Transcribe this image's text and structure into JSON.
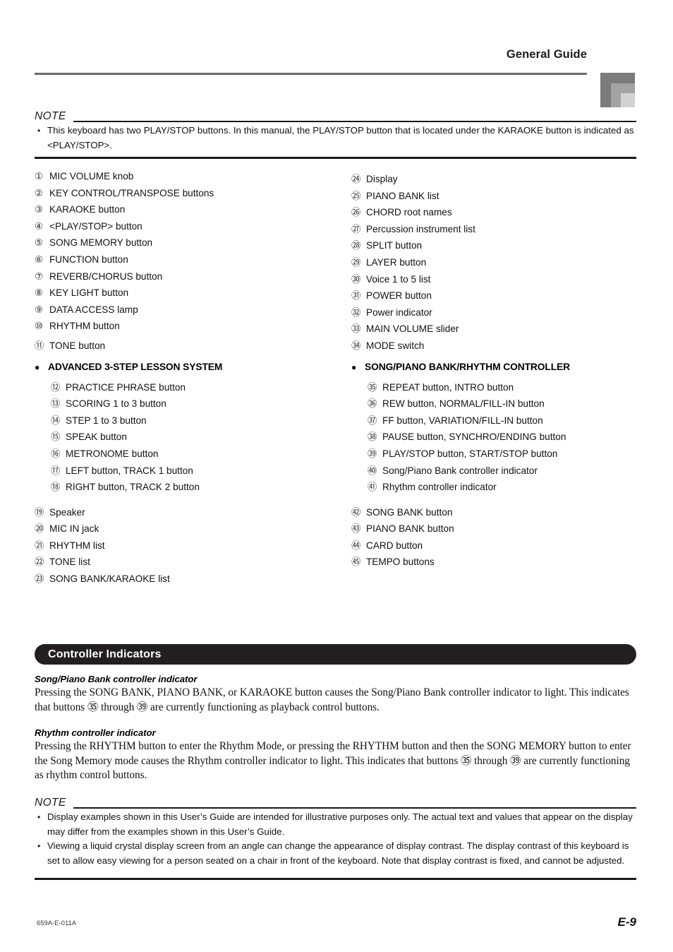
{
  "header": {
    "title": "General Guide",
    "corner_colors": [
      "#7b7b7b",
      "#a3a3a3",
      "#d2d2d2"
    ],
    "rule_color": "#6b6b6b"
  },
  "note_top": {
    "label": "NOTE",
    "items": [
      "This keyboard has two PLAY/STOP buttons. In this manual, the PLAY/STOP button that is located under the KARAOKE button is indicated as <PLAY/STOP>."
    ]
  },
  "index": {
    "left_column": {
      "items_before": [
        {
          "num": "①",
          "text": "MIC VOLUME knob"
        },
        {
          "num": "②",
          "text": "KEY CONTROL/TRANSPOSE buttons"
        },
        {
          "num": "③",
          "text": "KARAOKE button"
        },
        {
          "num": "④",
          "text": "<PLAY/STOP> button"
        },
        {
          "num": "⑤",
          "text": "SONG MEMORY button"
        },
        {
          "num": "⑥",
          "text": "FUNCTION button"
        },
        {
          "num": "⑦",
          "text": "REVERB/CHORUS button"
        },
        {
          "num": "⑧",
          "text": "KEY LIGHT button"
        },
        {
          "num": "⑨",
          "text": "DATA ACCESS lamp"
        },
        {
          "num": "⑩",
          "text": "RHYTHM button"
        },
        {
          "num": "⑪",
          "text": "TONE button"
        }
      ],
      "group": {
        "bullet": "●",
        "heading": "ADVANCED 3-STEP LESSON SYSTEM",
        "items": [
          {
            "num": "⑫",
            "text": "PRACTICE PHRASE button"
          },
          {
            "num": "⑬",
            "text": "SCORING 1 to 3 button"
          },
          {
            "num": "⑭",
            "text": "STEP 1 to 3 button"
          },
          {
            "num": "⑮",
            "text": "SPEAK button"
          },
          {
            "num": "⑯",
            "text": "METRONOME button"
          },
          {
            "num": "⑰",
            "text": "LEFT button, TRACK 1 button"
          },
          {
            "num": "⑱",
            "text": "RIGHT button, TRACK 2 button"
          }
        ]
      },
      "items_after": [
        {
          "num": "⑲",
          "text": "Speaker"
        },
        {
          "num": "⑳",
          "text": "MIC IN jack"
        },
        {
          "num": "㉑",
          "text": "RHYTHM list"
        },
        {
          "num": "㉒",
          "text": "TONE list"
        },
        {
          "num": "㉓",
          "text": "SONG BANK/KARAOKE list"
        }
      ]
    },
    "right_column": {
      "items_before": [
        {
          "num": "㉔",
          "text": "Display"
        },
        {
          "num": "㉕",
          "text": "PIANO BANK list"
        },
        {
          "num": "㉖",
          "text": "CHORD root names"
        },
        {
          "num": "㉗",
          "text": "Percussion instrument list"
        },
        {
          "num": "㉘",
          "text": "SPLIT button"
        },
        {
          "num": "㉙",
          "text": "LAYER button"
        },
        {
          "num": "㉚",
          "text": "Voice 1 to 5 list"
        },
        {
          "num": "㉛",
          "text": "POWER button"
        },
        {
          "num": "㉜",
          "text": "Power indicator"
        },
        {
          "num": "㉝",
          "text": "MAIN VOLUME slider"
        },
        {
          "num": "㉞",
          "text": "MODE switch"
        }
      ],
      "group": {
        "bullet": "●",
        "heading": "SONG/PIANO BANK/RHYTHM CONTROLLER",
        "items": [
          {
            "num": "㉟",
            "text": "REPEAT button, INTRO button"
          },
          {
            "num": "㊱",
            "text": "REW button, NORMAL/FILL-IN button"
          },
          {
            "num": "㊲",
            "text": "FF button, VARIATION/FILL-IN button"
          },
          {
            "num": "㊳",
            "text": "PAUSE button, SYNCHRO/ENDING button"
          },
          {
            "num": "㊴",
            "text": "PLAY/STOP button, START/STOP button"
          },
          {
            "num": "㊵",
            "text": "Song/Piano Bank controller indicator"
          },
          {
            "num": "㊶",
            "text": "Rhythm controller indicator"
          }
        ]
      },
      "items_after": [
        {
          "num": "㊷",
          "text": "SONG BANK button"
        },
        {
          "num": "㊸",
          "text": "PIANO BANK button"
        },
        {
          "num": "㊹",
          "text": "CARD button"
        },
        {
          "num": "㊺",
          "text": "TEMPO buttons"
        }
      ]
    }
  },
  "section": {
    "banner_title": "Controller Indicators",
    "banner_color": "#231f20",
    "entries": [
      {
        "heading": "Song/Piano Bank controller indicator",
        "body": "Pressing the SONG BANK, PIANO BANK, or KARAOKE button causes the Song/Piano Bank controller indicator to light. This indicates that buttons ㉟ through ㊴ are currently functioning as playback control buttons."
      },
      {
        "heading": "Rhythm controller indicator",
        "body": "Pressing the RHYTHM button to enter the Rhythm Mode, or pressing the RHYTHM button and then the SONG MEMORY button to enter the Song Memory mode causes the Rhythm controller indicator to light. This indicates that buttons ㉟ through ㊴ are currently functioning as rhythm control buttons."
      }
    ]
  },
  "note_bottom": {
    "label": "NOTE",
    "items": [
      "Display examples shown in this User’s Guide are intended for illustrative purposes only. The actual text and values that appear on the display may differ from the examples shown in this User’s Guide.",
      "Viewing a liquid crystal display screen from an angle can change the appearance of display contrast. The display contrast of this keyboard is set to allow easy viewing for a person seated on a chair in front of the keyboard. Note that display contrast is fixed, and cannot be adjusted."
    ]
  },
  "footer": {
    "code": "659A-E-011A",
    "page": "E-9"
  }
}
